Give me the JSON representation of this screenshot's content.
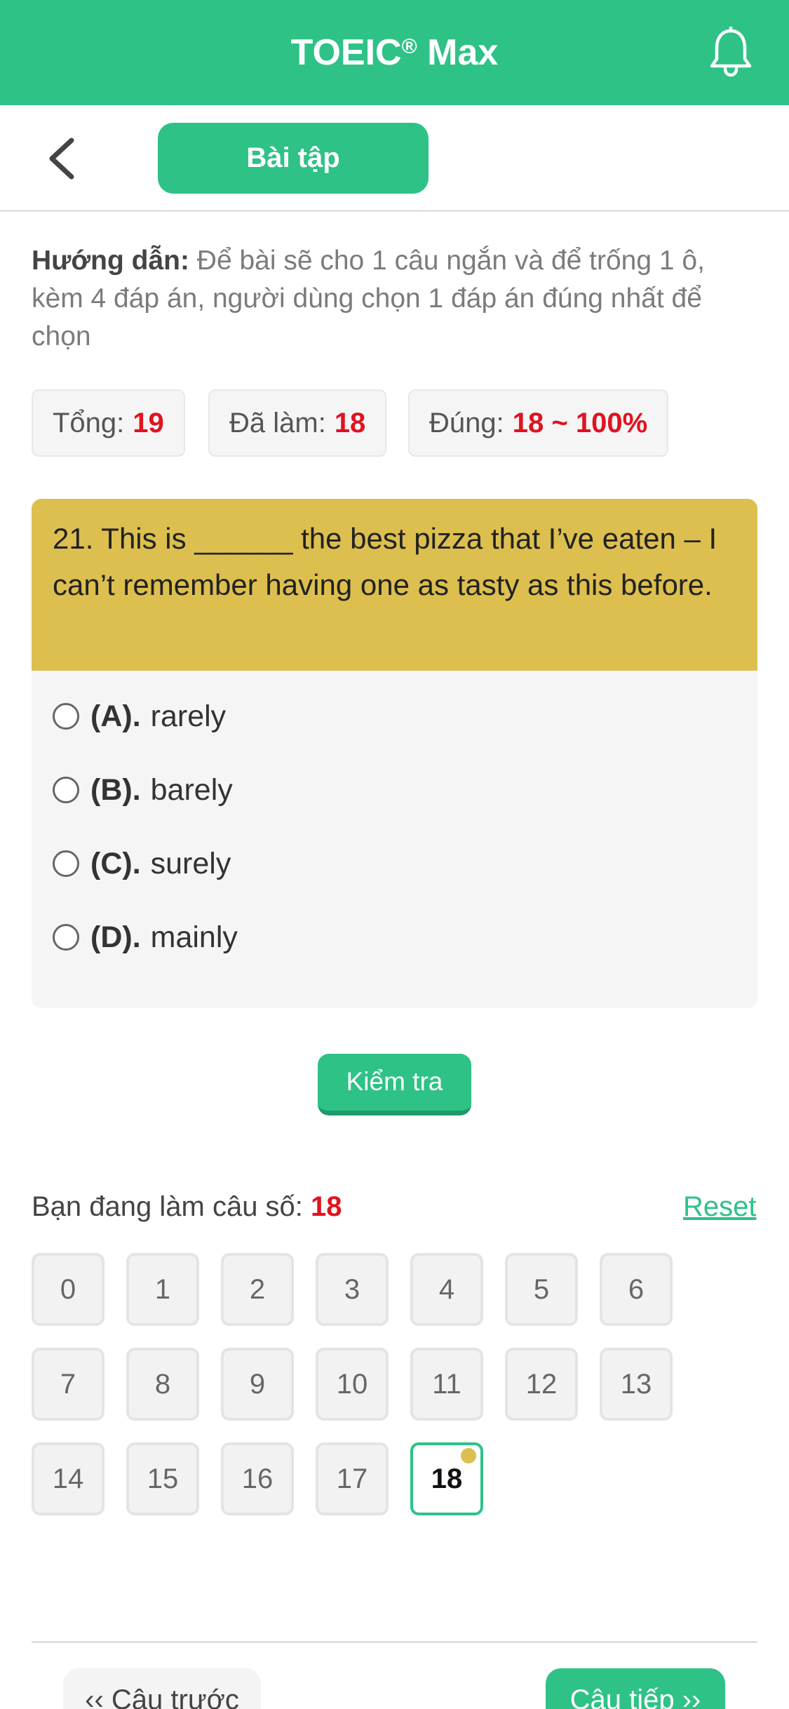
{
  "header": {
    "title": "TOEIC",
    "title_mark": "®",
    "title_suffix": " Max"
  },
  "subbar": {
    "tab_label": "Bài tập"
  },
  "instructions": {
    "label": "Hướng dẫn:",
    "text": " Để bài sẽ cho 1 câu ngắn và để trống 1 ô, kèm 4 đáp án, người dùng chọn 1 đáp án đúng nhất để chọn"
  },
  "stats": {
    "total_label": "Tổng:",
    "total_value": "19",
    "done_label": "Đã làm:",
    "done_value": "18",
    "correct_label": "Đúng:",
    "correct_value": "18 ~ 100%"
  },
  "question": {
    "text": "21. This is ______ the best pizza that I’ve eaten – I can’t remember having one as tasty as this before.",
    "options": [
      {
        "label": "(A).",
        "text": "rarely"
      },
      {
        "label": "(B).",
        "text": "barely"
      },
      {
        "label": "(C).",
        "text": "surely"
      },
      {
        "label": "(D).",
        "text": "mainly"
      }
    ]
  },
  "check_button": "Kiểm tra",
  "progress": {
    "label": "Bạn đang làm câu số: ",
    "current": "18",
    "reset": "Reset"
  },
  "grid": [
    "0",
    "1",
    "2",
    "3",
    "4",
    "5",
    "6",
    "7",
    "8",
    "9",
    "10",
    "11",
    "12",
    "13",
    "14",
    "15",
    "16",
    "17",
    "18"
  ],
  "active_index": 18,
  "nav": {
    "prev": "‹‹ Câu trước",
    "next": "Câu tiếp ››"
  },
  "colors": {
    "brand": "#2ec287",
    "question_header": "#dcbf4f",
    "highlight": "#e0131f"
  }
}
